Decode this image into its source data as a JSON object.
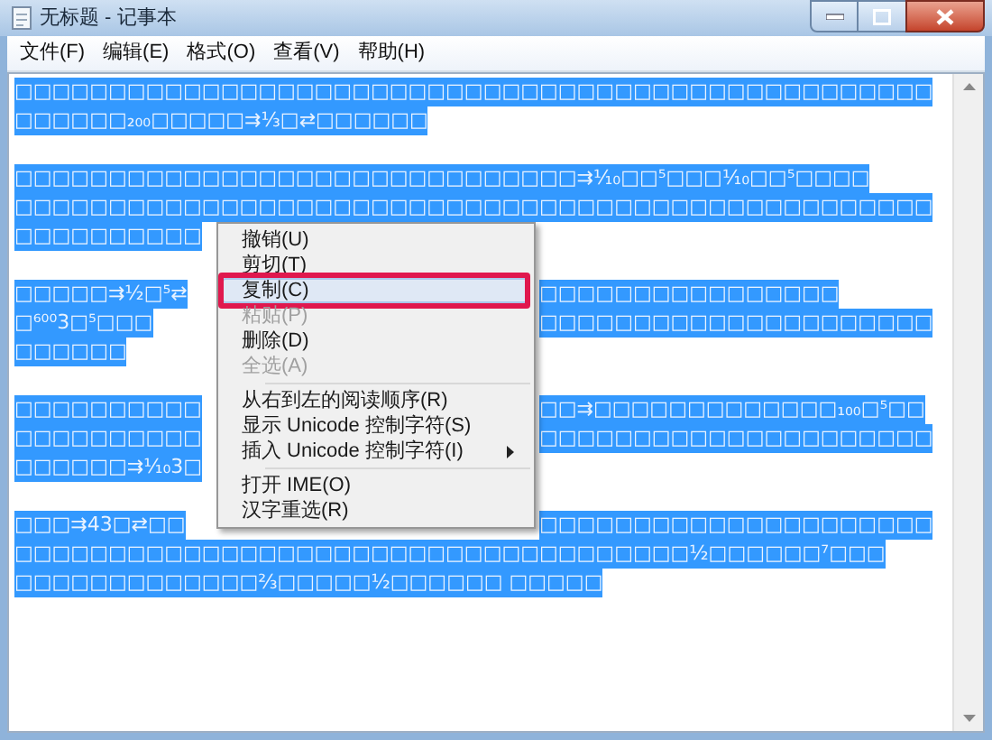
{
  "window": {
    "title": "无标题 - 记事本"
  },
  "menu_bar": [
    {
      "label": "文件(F)"
    },
    {
      "label": "编辑(E)"
    },
    {
      "label": "格式(O)"
    },
    {
      "label": "查看(V)"
    },
    {
      "label": "帮助(H)"
    }
  ],
  "document": {
    "selected": true,
    "paragraphs": [
      [
        [
          "□□□□□□□□□□□□□□□□□□□□□□□□□□□□□□□□□□□□□□□□□□□□□□□□□"
        ],
        [
          "□□□□□□₂₀₀□□□□□⇉⅓□⇄□□□□□□"
        ]
      ],
      [
        [
          "□□□□□□□□□□□□□□□□□□□□□□□□□□□□□□⇉⅒□□⁵□□□⅒□□⁵□□□□"
        ],
        [
          "□□□□□□□□□□□□□□□□□□□□□□□□□□□□□□□□□□□□□□□□□□□□□□□□□"
        ],
        [
          "□□□□□□□□□□"
        ]
      ],
      [
        [
          "□□□□□⇉½□⁵⇄",
          "□□□□□□□□□□□□□□□□"
        ],
        [
          "□⁶⁰⁰3□⁵□□□",
          "□□□□□□□□□□□□□□□□□□□□□"
        ],
        [
          "□□□□□□"
        ]
      ],
      [
        [
          "□□□□□□□□□□",
          "□□⇉□□□□□□□□□□□□□₁₀₀□⁵□□"
        ],
        [
          "□□□□□□□□□□",
          "□□□□□□□□□□□□□□□□□□□□□"
        ],
        [
          "□□□□□□⇉⅒3□"
        ]
      ],
      [
        [
          "□□□⇉43□⇄□□",
          "□□□□□□□□□□□□□□□□□□□□□"
        ],
        [
          "□□□□□□□□□□□□□□□□□□□□□□□□□□□□□□□□□□□□½□□□□□□⁷□□□"
        ],
        [
          "□□□□□□□□□□□□□⅔□□□□□½□□□□□□ □□□□□"
        ]
      ]
    ]
  },
  "context_menu": {
    "items": [
      {
        "kind": "item",
        "label": "撤销(U)",
        "disabled": false,
        "selected": false,
        "marked": false,
        "submenu": false
      },
      {
        "kind": "item",
        "label": "剪切(T)",
        "disabled": false,
        "selected": false,
        "marked": false,
        "submenu": false
      },
      {
        "kind": "item",
        "label": "复制(C)",
        "disabled": false,
        "selected": true,
        "marked": true,
        "submenu": false
      },
      {
        "kind": "item",
        "label": "粘贴(P)",
        "disabled": true,
        "selected": false,
        "marked": false,
        "submenu": false
      },
      {
        "kind": "item",
        "label": "删除(D)",
        "disabled": false,
        "selected": false,
        "marked": false,
        "submenu": false
      },
      {
        "kind": "item",
        "label": "全选(A)",
        "disabled": true,
        "selected": false,
        "marked": false,
        "submenu": false
      },
      {
        "kind": "separator"
      },
      {
        "kind": "item",
        "label": "从右到左的阅读顺序(R)",
        "disabled": false,
        "selected": false,
        "marked": false,
        "submenu": false
      },
      {
        "kind": "item",
        "label": "显示 Unicode 控制字符(S)",
        "disabled": false,
        "selected": false,
        "marked": false,
        "submenu": false
      },
      {
        "kind": "item",
        "label": "插入 Unicode 控制字符(I)",
        "disabled": false,
        "selected": false,
        "marked": false,
        "submenu": true
      },
      {
        "kind": "separator"
      },
      {
        "kind": "item",
        "label": "打开 IME(O)",
        "disabled": false,
        "selected": false,
        "marked": false,
        "submenu": false
      },
      {
        "kind": "item",
        "label": "汉字重选(R)",
        "disabled": false,
        "selected": false,
        "marked": false,
        "submenu": false
      }
    ]
  }
}
